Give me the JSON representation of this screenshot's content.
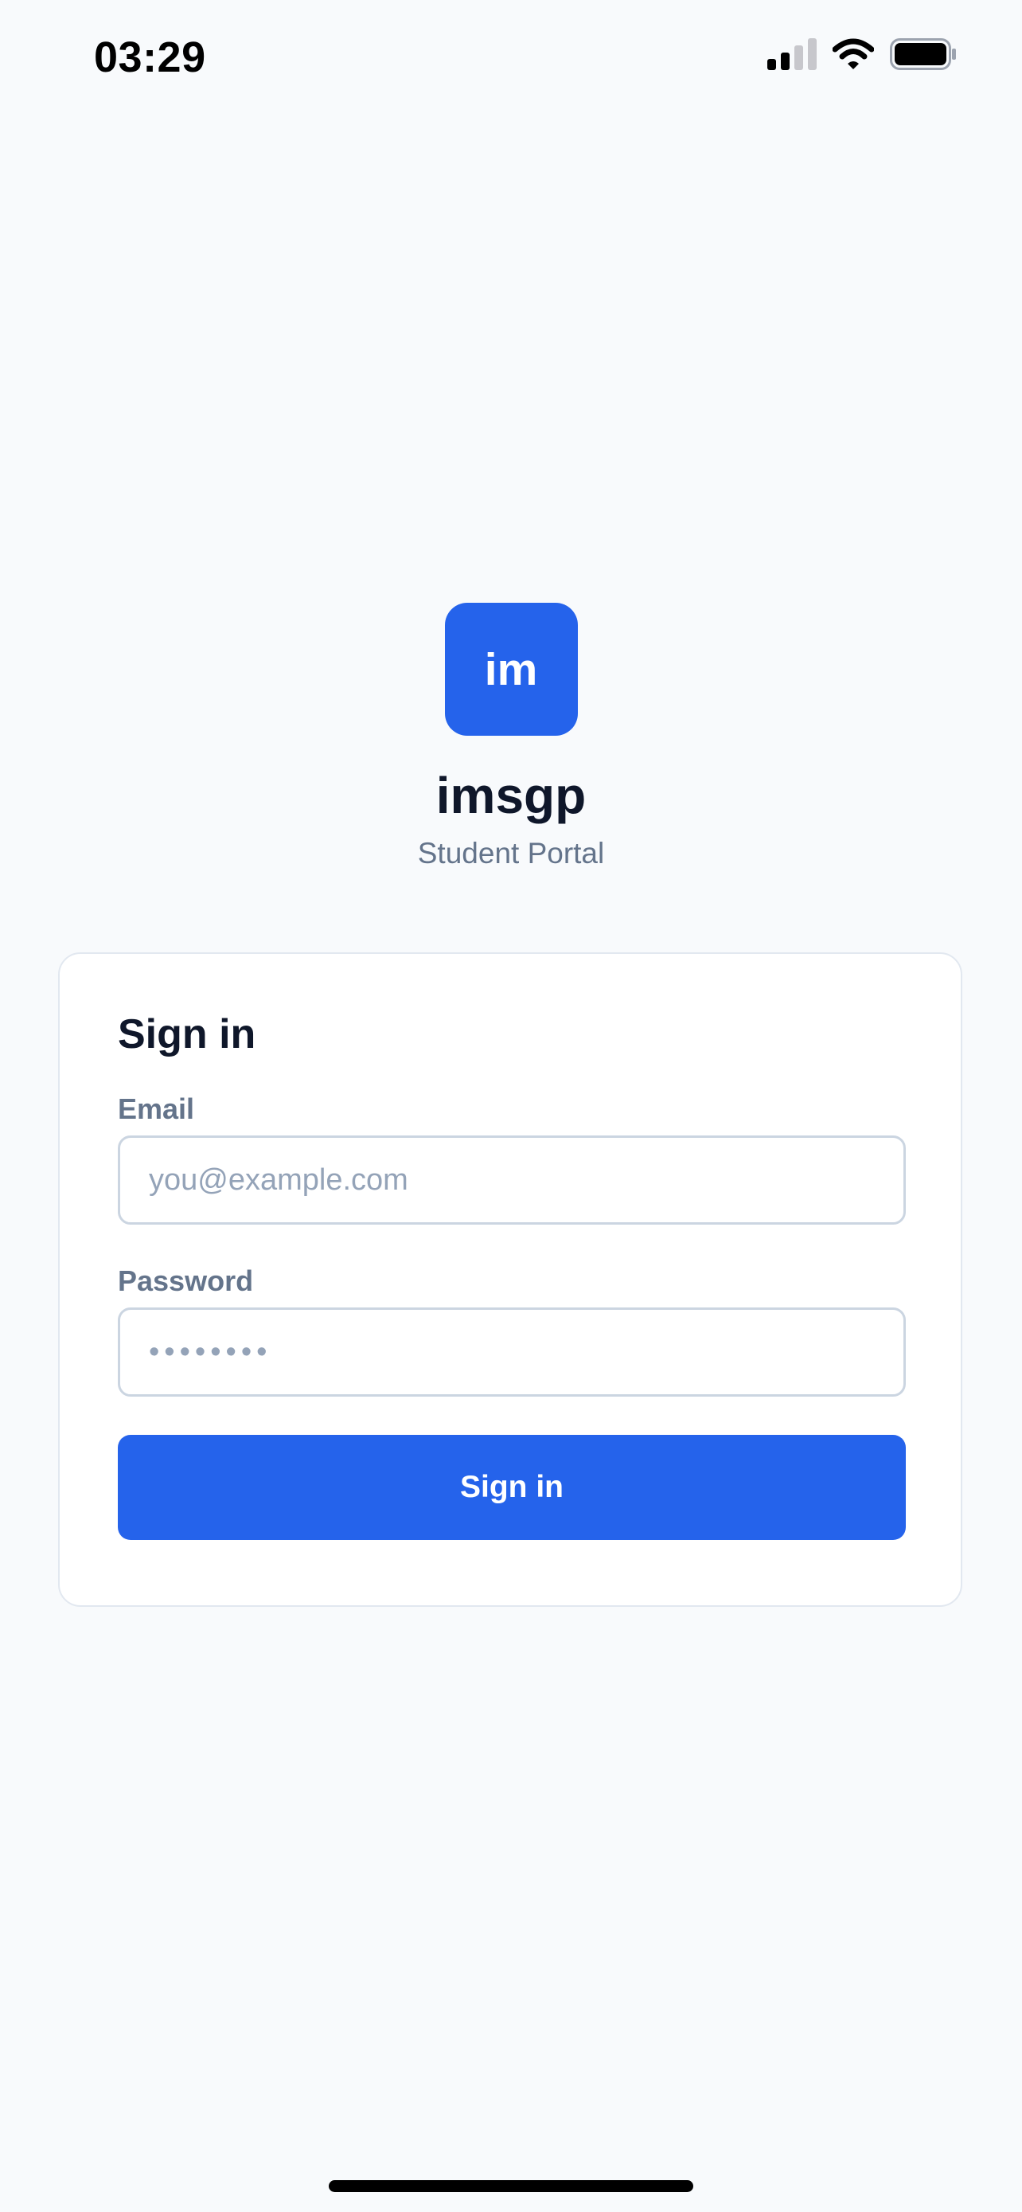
{
  "status_bar": {
    "time": "03:29",
    "signal_icon": "cellular-signal-icon",
    "wifi_icon": "wifi-icon",
    "battery_icon": "battery-icon"
  },
  "brand": {
    "logo_text": "im",
    "app_name": "imsgp",
    "subtitle": "Student Portal",
    "accent_color": "#2563eb"
  },
  "signin_card": {
    "title": "Sign in",
    "email": {
      "label": "Email",
      "placeholder": "you@example.com",
      "value": ""
    },
    "password": {
      "label": "Password",
      "placeholder": "••••••••",
      "value": ""
    },
    "submit_label": "Sign in"
  }
}
